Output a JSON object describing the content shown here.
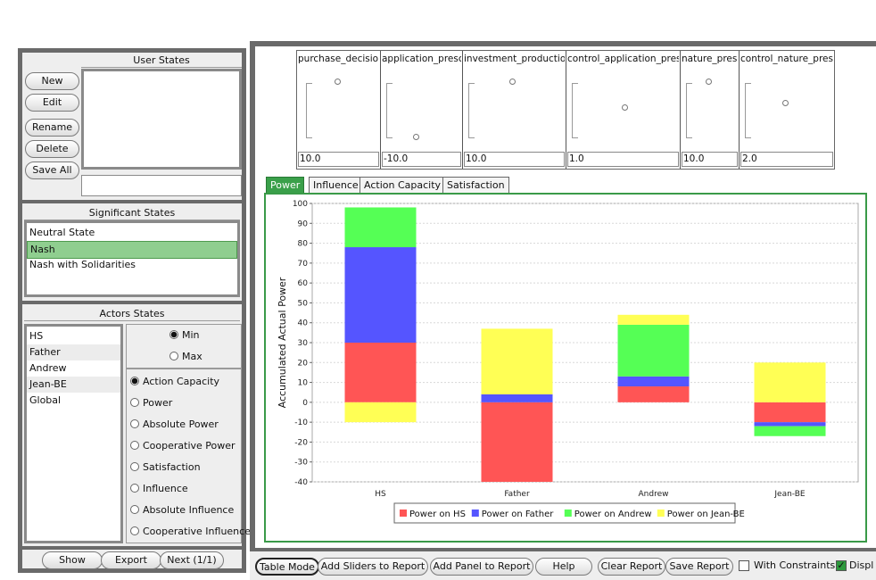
{
  "user_states": {
    "title": "User States",
    "buttons": [
      "New",
      "Edit",
      "Rename",
      "Delete",
      "Save All"
    ]
  },
  "significant_states": {
    "title": "Significant States",
    "items": [
      "Neutral State",
      "Nash",
      "Nash with Solidarities"
    ],
    "selected_index": 1
  },
  "actors_states": {
    "title": "Actors States",
    "actors": [
      "HS",
      "Father",
      "Andrew",
      "Jean-BE",
      "Global"
    ],
    "min_label": "Min",
    "max_label": "Max",
    "min_selected": true,
    "metrics": [
      "Action Capacity",
      "Power",
      "Absolute Power",
      "Cooperative Power",
      "Satisfaction",
      "Influence",
      "Absolute Influence",
      "Cooperative Influence"
    ],
    "selected_metric_index": 0
  },
  "bottom_left": {
    "show": "Show",
    "export": "Export",
    "next": "Next (1/1)"
  },
  "sliders": [
    {
      "name": "purchase_decision",
      "value": "10.0",
      "level": 1.0
    },
    {
      "name": "application_presc",
      "value": "-10.0",
      "level": 0.0
    },
    {
      "name": "investment_production",
      "value": "10.0",
      "level": 1.0
    },
    {
      "name": "control_application_presc",
      "value": "1.0",
      "level": 0.55
    },
    {
      "name": "nature_presc",
      "value": "10.0",
      "level": 1.0
    },
    {
      "name": "control_nature_presc",
      "value": "2.0",
      "level": 0.6
    }
  ],
  "tabs": [
    "Power",
    "Influence",
    "Action Capacity",
    "Satisfaction"
  ],
  "active_tab": 0,
  "toolbar": {
    "buttons": [
      "Table Mode",
      "Add Sliders to Report",
      "Add Panel to Report",
      "Help",
      "Clear Report",
      "Save Report"
    ],
    "with_constraints_label": "With Constraints",
    "with_constraints_checked": false,
    "display_label": "Display",
    "display_checked": true
  },
  "colors": {
    "red": "#ff5555",
    "blue": "#5555ff",
    "green": "#55ff55",
    "yellow": "#ffff55",
    "tab_active": "#3aa04a"
  },
  "chart_data": {
    "type": "bar",
    "stacked": true,
    "title": "",
    "xlabel": "",
    "ylabel": "Accumulated Actual Power",
    "ylim": [
      -40,
      100
    ],
    "yticks": [
      100,
      90,
      80,
      70,
      60,
      50,
      40,
      30,
      20,
      10,
      0,
      -10,
      -20,
      -30,
      -40
    ],
    "categories": [
      "HS",
      "Father",
      "Andrew",
      "Jean-BE"
    ],
    "series": [
      {
        "name": "Power on HS",
        "color": "#ff5555",
        "values": [
          30,
          -40,
          8,
          -10
        ]
      },
      {
        "name": "Power on Father",
        "color": "#5555ff",
        "values": [
          48,
          4,
          5,
          -2
        ]
      },
      {
        "name": "Power on Andrew",
        "color": "#55ff55",
        "values": [
          20,
          0,
          26,
          -5
        ]
      },
      {
        "name": "Power on Jean-BE",
        "color": "#ffff55",
        "values": [
          -10,
          33,
          5,
          20
        ]
      }
    ],
    "grid": true,
    "legend_position": "bottom"
  }
}
